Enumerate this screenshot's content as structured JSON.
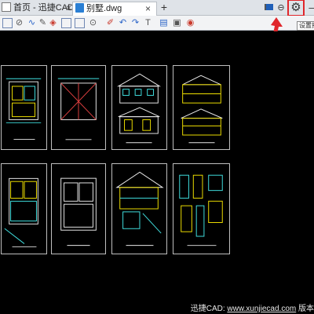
{
  "tabs": {
    "home_label": "首页 - 迅捷CAD看图",
    "file_label": "别墅.dwg",
    "close_glyph": "×",
    "new_tab_glyph": "+"
  },
  "window": {
    "settings_glyph": "⚙",
    "minimize_glyph": "–",
    "zoom_glyph": "⊖",
    "settings_tooltip": "设置打"
  },
  "toolbar": {
    "icons": [
      "open-file-icon",
      "pan-icon",
      "sketch-icon",
      "pencil-icon",
      "eraser-tag-icon",
      "rectangle-icon",
      "rectangle-icon",
      "measure-icon",
      "pencil-icon",
      "undo-icon",
      "redo-icon",
      "text-icon",
      "layers-icon",
      "view-icon",
      "color-wheel-icon"
    ]
  },
  "status": {
    "prefix": "迅捷CAD: ",
    "url": "www.xunjiecad.com",
    "suffix": " 版本"
  },
  "colors": {
    "highlight": "#e0262b",
    "canvas": "#000000",
    "cad_yellow": "#f0e000",
    "cad_cyan": "#40e0e0",
    "cad_white": "#e8e8e8",
    "cad_red": "#e04040"
  }
}
